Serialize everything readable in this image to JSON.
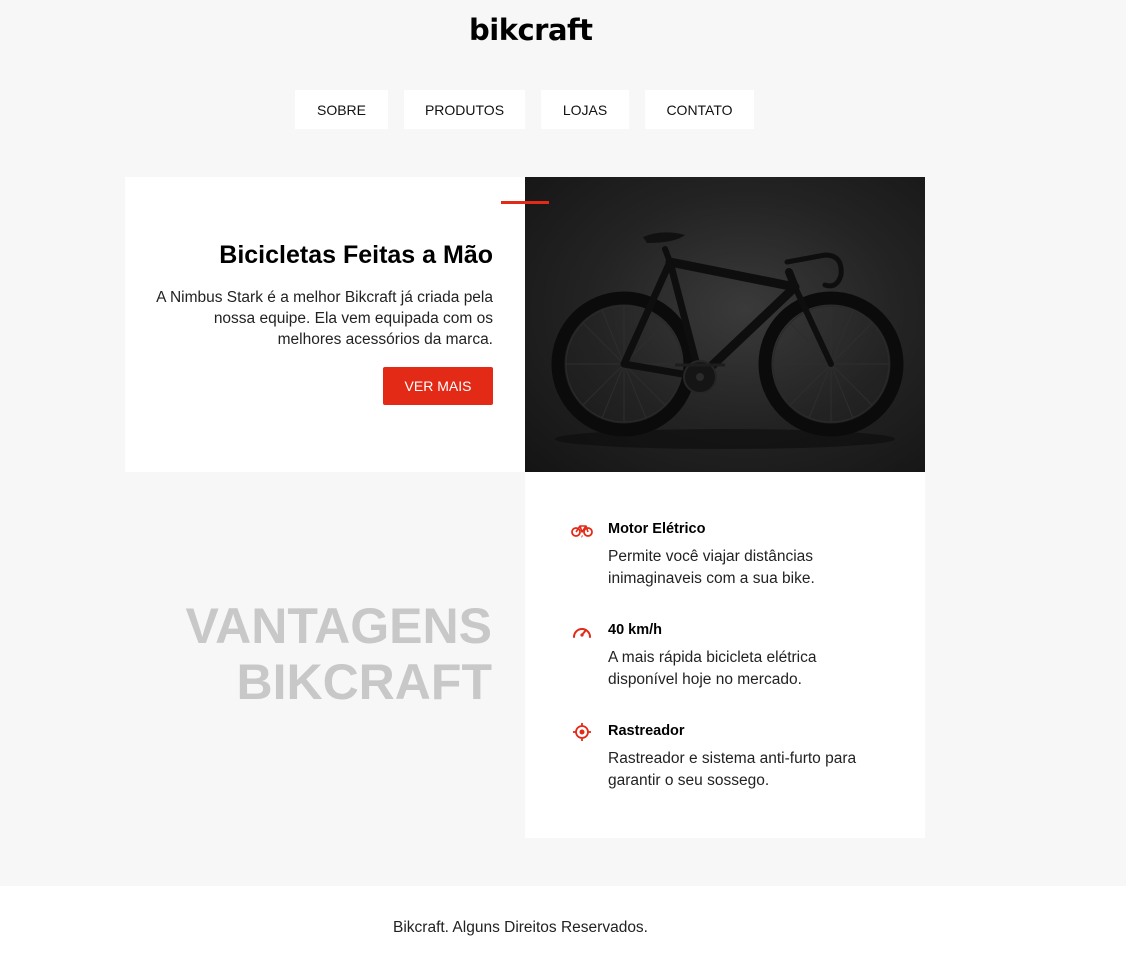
{
  "header": {
    "logo": "bikcraft"
  },
  "nav": {
    "items": [
      {
        "label": "SOBRE"
      },
      {
        "label": "PRODUTOS"
      },
      {
        "label": "LOJAS"
      },
      {
        "label": "CONTATO"
      }
    ]
  },
  "hero": {
    "title": "Bicicletas Feitas a Mão",
    "description": "A Nimbus Stark é a melhor Bikcraft já criada pela nossa equipe. Ela vem equipada com os melhores acessórios da marca.",
    "button_label": "VER MAIS",
    "accent_color": "#e32a17"
  },
  "vantagens": {
    "title_line1": "VANTAGENS",
    "title_line2": "BIKCRAFT",
    "features": [
      {
        "icon": "electric-bike-icon",
        "title": "Motor Elétrico",
        "description": "Permite você viajar distâncias inimaginaveis com a sua bike."
      },
      {
        "icon": "speedometer-icon",
        "title": "40 km/h",
        "description": "A mais rápida bicicleta elétrica disponível hoje no mercado."
      },
      {
        "icon": "target-icon",
        "title": "Rastreador",
        "description": "Rastreador e sistema anti-furto para garantir o seu sossego."
      }
    ]
  },
  "footer": {
    "text": "Bikcraft. Alguns Direitos Reservados."
  }
}
